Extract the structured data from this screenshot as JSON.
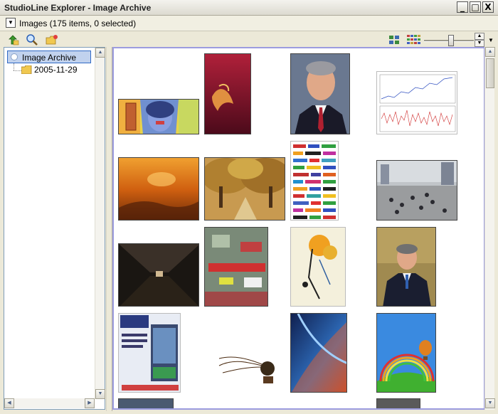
{
  "window": {
    "title": "StudioLine Explorer - Image Archive",
    "minimize": "_",
    "maximize": "□",
    "close": "X"
  },
  "subbar": {
    "label": "Images  (175 items, 0 selected)"
  },
  "toolbar": {
    "icons": [
      "up-folder-icon",
      "search-icon",
      "new-folder-icon"
    ],
    "view_icons": [
      "grid-view-icon",
      "thumbnail-view-icon"
    ],
    "zoom_level": 0.5
  },
  "tree": {
    "root": "Image Archive",
    "child": "2005-11-29"
  },
  "colors": {
    "selection": "#c1d2ee",
    "content_border": "#9c9cdf",
    "folder": "#f0c850"
  },
  "thumbnails": [
    {
      "name": "cartoon-woman-thumbnail"
    },
    {
      "name": "red-abstract-thumbnail"
    },
    {
      "name": "portrait-man-thumbnail"
    },
    {
      "name": "stock-chart-thumbnail"
    },
    {
      "name": "orange-sunset-thumbnail"
    },
    {
      "name": "autumn-trees-thumbnail"
    },
    {
      "name": "logo-collage-thumbnail"
    },
    {
      "name": "street-crowd-thumbnail"
    },
    {
      "name": "dark-corridor-thumbnail"
    },
    {
      "name": "city-signs-thumbnail"
    },
    {
      "name": "floral-illustration-thumbnail"
    },
    {
      "name": "president-podium-thumbnail"
    },
    {
      "name": "vending-poster-thumbnail"
    },
    {
      "name": "gramophone-art-thumbnail"
    },
    {
      "name": "blue-tunnel-thumbnail"
    },
    {
      "name": "rainbow-balloon-thumbnail"
    }
  ]
}
